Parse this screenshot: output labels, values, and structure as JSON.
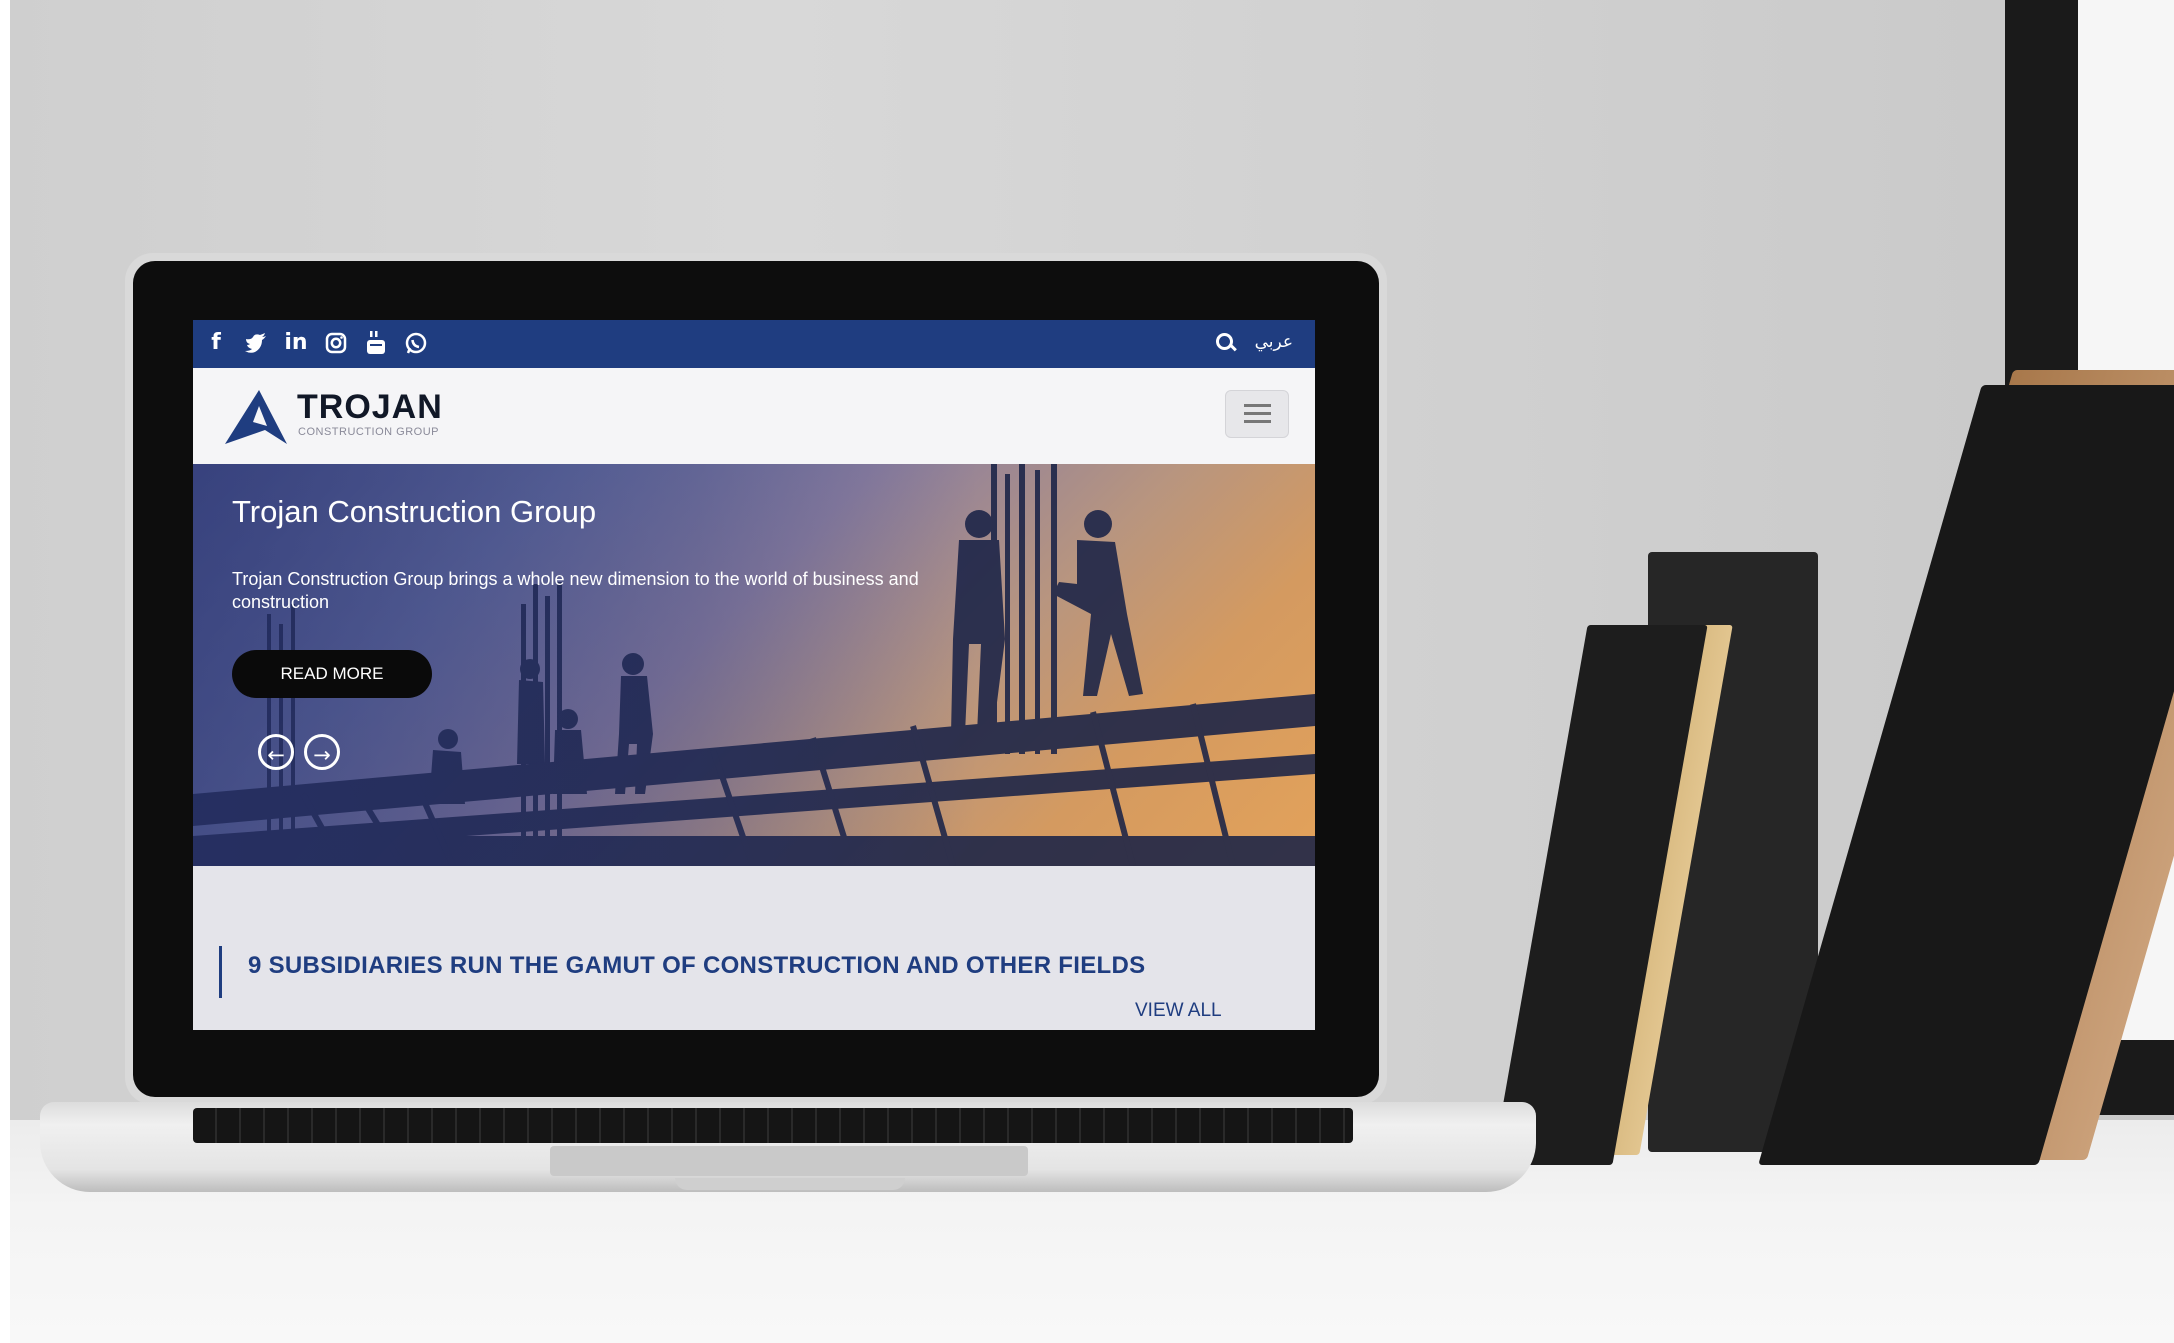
{
  "topbar": {
    "social_icons": [
      "facebook-icon",
      "twitter-icon",
      "linkedin-icon",
      "instagram-icon",
      "youtube-icon",
      "whatsapp-icon"
    ],
    "language_label": "عربي",
    "color": "#1f3d80"
  },
  "header": {
    "brand_name": "TROJAN",
    "brand_tagline": "CONSTRUCTION GROUP",
    "menu_icon": "hamburger-menu-icon"
  },
  "hero": {
    "title": "Trojan Construction Group",
    "text": "Trojan Construction Group brings a whole new dimension to the world of business and construction",
    "button_label": "READ MORE",
    "prev_icon": "arrow-left-circle-icon",
    "next_icon": "arrow-right-circle-icon"
  },
  "section": {
    "heading": "9 SUBSIDIARIES RUN THE GAMUT OF CONSTRUCTION AND OTHER FIELDS",
    "view_all_label": "VIEW ALL"
  },
  "colors": {
    "brand_blue": "#1f3d80",
    "button_black": "#0a0a0a"
  }
}
